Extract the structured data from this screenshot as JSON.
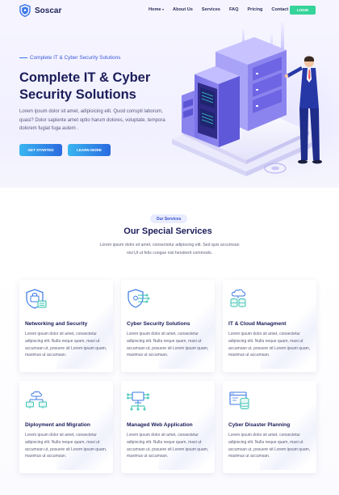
{
  "brand": {
    "name": "Soscar",
    "icon": "shield-logo-icon"
  },
  "nav": {
    "items": [
      {
        "label": "Home",
        "dropdown": true
      },
      {
        "label": "About Us"
      },
      {
        "label": "Services"
      },
      {
        "label": "FAQ"
      },
      {
        "label": "Pricing"
      },
      {
        "label": "Contact"
      }
    ],
    "login_label": "LOGIN"
  },
  "hero": {
    "eyebrow": "Complete IT & Cyber Security Solutions",
    "title": "Complete IT & Cyber Security Solutions",
    "description": "Lorem ipsum dolor sit amet, adipisicing elit. Quod corrupti laborum, quasi? Dolor sapiente amet optio harum dolores, voluptate, tempora dolorem fugiat fuga autem .",
    "cta_primary": "GET STARTED",
    "cta_secondary": "LEARN MORE",
    "illustration": "server-rack-with-businessman-illustration"
  },
  "services": {
    "pill": "Our Services",
    "title": "Our Special Services",
    "description": "Lorem ipsum dolor sit amet, consectetur adipiscing elit. Sed quis accumsan nisi Ut ut felis congue nisl hendrerit commodo.",
    "cards": [
      {
        "title": "Networking and Security",
        "icon": "shield-network-icon",
        "text": "Lorem ipsum dolor sit amet, consectetur adipiscing elit. Nulla neque quam, maxi ut accumsan ut, posuere sit Lorem ipsum quam, maximus ut accumsan."
      },
      {
        "title": "Cyber Security Solutions",
        "icon": "shield-circuit-icon",
        "text": "Lorem ipsum dolor sit amet, consectetur adipiscing elit. Nulla neque quam, maxi ut accumsan ut, posuere sit Lorem ipsum quam, maximus ut accumsan."
      },
      {
        "title": "IT & Cloud Managment",
        "icon": "cloud-database-icon",
        "text": "Lorem ipsum dolor sit amet, consectetur adipiscing elit. Nulla neque quam, maxi ut accumsan ut, posuere sit Lorem ipsum quam, maximus ut accumsan."
      },
      {
        "title": "Diployment and Migration",
        "icon": "cloud-monitors-icon",
        "text": "Lorem ipsum dolor sit amet, consectetur adipiscing elit. Nulla neque quam, maxi ut accumsan ut, posuere sit Lorem ipsum quam, maximus ut accumsan."
      },
      {
        "title": "Managed Web Application",
        "icon": "monitor-network-icon",
        "text": "Lorem ipsum dolor sit amet, consectetur adipiscing elit. Nulla neque quam, maxi ut accumsan ut, posuere sit Lorem ipsum quam, maximus ut accumsan."
      },
      {
        "title": "Cyber Disaster Planning",
        "icon": "browser-database-icon",
        "text": "Lorem ipsum dolor sit amet, consectetur adipiscing elit. Nulla neque quam, maxi ut accumsan ut, posuere sit Lorem ipsum quam, maximus ut accumsan."
      }
    ]
  },
  "colors": {
    "brand": "#1c2257",
    "accent_green": "#35d49a",
    "accent_blue": "#2a6ae0",
    "icon_blue": "#3c78e6",
    "icon_teal": "#2fbfae",
    "hero_bg": "#f3f2ff"
  }
}
